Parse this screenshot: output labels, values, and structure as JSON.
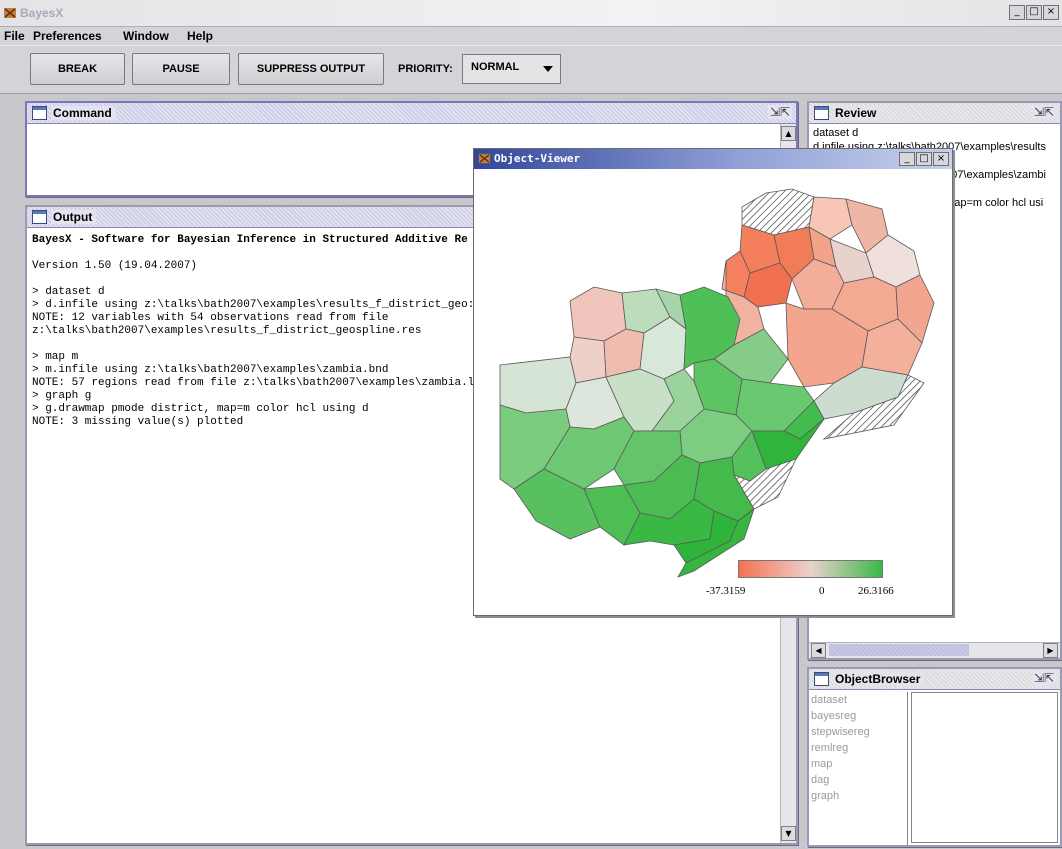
{
  "app": {
    "title": "BayesX",
    "window_controls": [
      "_",
      "□",
      "×"
    ]
  },
  "menu": [
    {
      "label": "File"
    },
    {
      "label": "Preferences"
    },
    {
      "label": "Window"
    },
    {
      "label": "Help"
    }
  ],
  "toolbar": {
    "break_label": "BREAK",
    "pause_label": "PAUSE",
    "suppress_label": "SUPPRESS OUTPUT",
    "priority_label": "PRIORITY:",
    "priority_value": "NORMAL"
  },
  "command": {
    "title": "Command",
    "value": ""
  },
  "output": {
    "title": "Output",
    "lines": [
      "BayesX - Software for Bayesian Inference in Structured Additive Re",
      "",
      "Version 1.50 (19.04.2007)",
      "",
      "> dataset d",
      "> d.infile using z:\\talks\\bath2007\\examples\\results_f_district_geo:",
      "NOTE: 12 variables with 54 observations read from file",
      "z:\\talks\\bath2007\\examples\\results_f_district_geospline.res",
      "",
      "> map m",
      "> m.infile using z:\\talks\\bath2007\\examples\\zambia.bnd",
      "NOTE: 57 regions read from file z:\\talks\\bath2007\\examples\\zambia.l",
      "> graph g",
      "> g.drawmap pmode district, map=m color hcl using d",
      "NOTE: 3 missing value(s) plotted"
    ]
  },
  "review": {
    "title": "Review",
    "lines": [
      "dataset d",
      "d.infile using z:\\talks\\bath2007\\examples\\results",
      "",
      "",
      "map m",
      "m.infile using z:\\talks\\bath2007\\examples\\zambi",
      "graph g",
      "g.drawmap pmode district, map=m color hcl usi"
    ]
  },
  "object_browser": {
    "title": "ObjectBrowser",
    "items": [
      "dataset",
      "bayesreg",
      "stepwisereg",
      "remlreg",
      "map",
      "dag",
      "graph"
    ]
  },
  "viewer": {
    "title": "Object-Viewer",
    "legend": {
      "min": "-37.3159",
      "mid": "0",
      "max": "26.3166"
    },
    "colors": {
      "low": "#f87050",
      "mid": "#ead2cc",
      "high": "#3ab84a"
    }
  }
}
